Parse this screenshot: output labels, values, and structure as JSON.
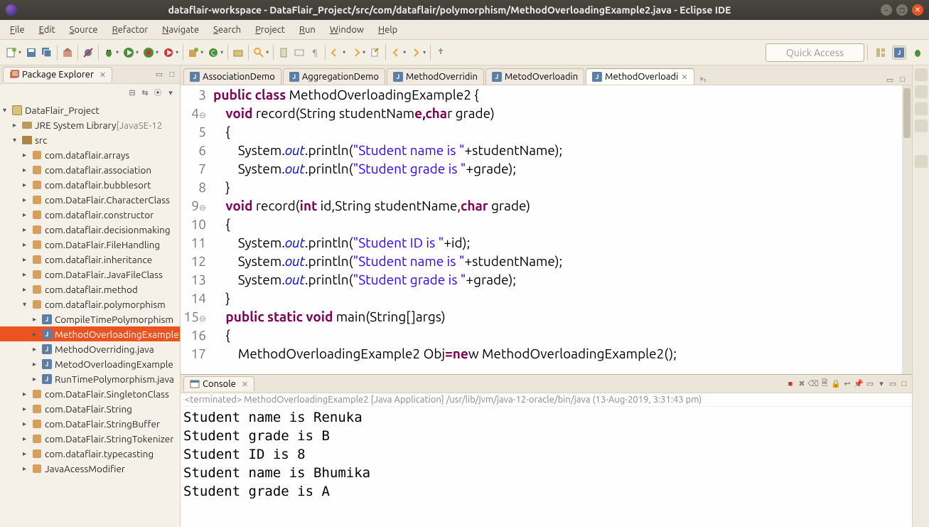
{
  "window": {
    "title": "dataflair-workspace - DataFlair_Project/src/com/dataflair/polymorphism/MethodOverloadingExample2.java - Eclipse IDE"
  },
  "menus": [
    "File",
    "Edit",
    "Source",
    "Refactor",
    "Navigate",
    "Search",
    "Project",
    "Run",
    "Window",
    "Help"
  ],
  "quick_access": "Quick Access",
  "package_explorer": {
    "title": "Package Explorer",
    "project": "DataFlair_Project",
    "jre": "JRE System Library",
    "jre_version": "[JavaSE-12",
    "src": "src",
    "packages": [
      "com.dataflair.arrays",
      "com.dataflair.association",
      "com.dataflair.bubblesort",
      "com.DataFlair.CharacterClass",
      "com.dataflair.constructor",
      "com.dataflair.decisionmaking",
      "com.DataFlair.FileHandling",
      "com.dataflair.inheritance",
      "com.DataFlair.JavaFileClass",
      "com.dataflair.method"
    ],
    "open_package": "com.dataflair.polymorphism",
    "java_files": [
      "CompileTimePolymorphism",
      "MethodOverloadingExample",
      "MethodOverriding.java",
      "MetodOverloadingExample",
      "RunTimePolymorphism.java"
    ],
    "packages_after": [
      "com.DataFlair.SingletonClass",
      "com.DataFlair.String",
      "com.DataFlair.StringBuffer",
      "com.DataFlair.StringTokenizer",
      "com.dataflair.typecasting",
      "JavaAcessModifier"
    ]
  },
  "editor_tabs": [
    "AssociationDemo",
    "AggregationDemo",
    "MethodOverridin",
    "MetodOverloadin",
    "MethodOverloadi"
  ],
  "editor_overflow": "»₁",
  "code": {
    "lines": [
      {
        "n": "3",
        "t": "public class MethodOverloadingExample2 {",
        "hl": [
          [
            0,
            6,
            "kw"
          ],
          [
            7,
            12,
            "kw"
          ]
        ]
      },
      {
        "n": "4",
        "t": "    void record(String studentName,char grade)",
        "hl": [
          [
            4,
            8,
            "kw"
          ],
          [
            33,
            38,
            "kw"
          ]
        ]
      },
      {
        "n": "5",
        "t": "    {"
      },
      {
        "n": "6",
        "t": "        System.out.println(\"Student name is \"+studentName);",
        "hl": [
          [
            15,
            18,
            "fld"
          ],
          [
            27,
            45,
            "str"
          ]
        ]
      },
      {
        "n": "7",
        "t": "        System.out.println(\"Student grade is \"+grade);",
        "hl": [
          [
            15,
            18,
            "fld"
          ],
          [
            27,
            46,
            "str"
          ]
        ]
      },
      {
        "n": "8",
        "t": "    }"
      },
      {
        "n": "9",
        "t": "    void record(int id,String studentName,char grade)",
        "hl": [
          [
            4,
            8,
            "kw"
          ],
          [
            16,
            19,
            "kw"
          ],
          [
            42,
            46,
            "kw"
          ]
        ]
      },
      {
        "n": "10",
        "t": "    {"
      },
      {
        "n": "11",
        "t": "        System.out.println(\"Student ID is \"+id);",
        "hl": [
          [
            15,
            18,
            "fld"
          ],
          [
            27,
            43,
            "str"
          ]
        ]
      },
      {
        "n": "12",
        "t": "        System.out.println(\"Student name is \"+studentName);",
        "hl": [
          [
            15,
            18,
            "fld"
          ],
          [
            27,
            45,
            "str"
          ]
        ]
      },
      {
        "n": "13",
        "t": "        System.out.println(\"Student grade is \"+grade);",
        "hl": [
          [
            15,
            18,
            "fld"
          ],
          [
            27,
            46,
            "str"
          ]
        ]
      },
      {
        "n": "14",
        "t": "    }"
      },
      {
        "n": "15",
        "t": "    public static void main(String[]args)",
        "hl": [
          [
            4,
            10,
            "kw"
          ],
          [
            11,
            17,
            "kw"
          ],
          [
            18,
            22,
            "kw"
          ]
        ]
      },
      {
        "n": "16",
        "t": "    {"
      },
      {
        "n": "17",
        "t": "        MethodOverloadingExample2 Obj=new MethodOverloadingExample2();",
        "hl": [
          [
            37,
            40,
            "kw"
          ]
        ]
      }
    ],
    "annotations": {
      "4": "⊖",
      "9": "⊖",
      "15": "⊖"
    }
  },
  "console": {
    "title": "Console",
    "status": "<terminated> MethodOverloadingExample2 [Java Application] /usr/lib/jvm/java-12-oracle/bin/java (13-Aug-2019, 3:31:43 pm)",
    "output": [
      "Student name is Renuka",
      "Student grade is B",
      "Student ID is 8",
      "Student name is Bhumika",
      "Student grade is A"
    ]
  }
}
